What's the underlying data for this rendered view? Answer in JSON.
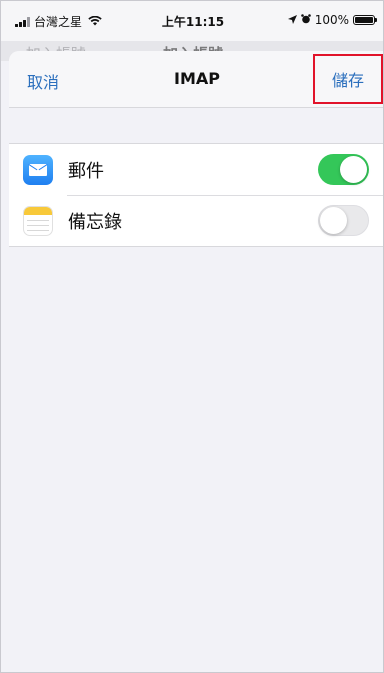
{
  "status_bar": {
    "carrier": "台灣之星",
    "time": "上午11:15",
    "battery": "100%"
  },
  "background_sheet": {
    "back_label": "加入帳號",
    "title": "加入帳號"
  },
  "nav": {
    "cancel_label": "取消",
    "title": "IMAP",
    "save_label": "儲存"
  },
  "items": [
    {
      "label": "郵件",
      "icon": "mail-icon",
      "enabled": true
    },
    {
      "label": "備忘錄",
      "icon": "notes-icon",
      "enabled": false
    }
  ],
  "colors": {
    "accent": "#2b6fbd",
    "toggle_on": "#34c759",
    "highlight_box": "#e1132a"
  }
}
